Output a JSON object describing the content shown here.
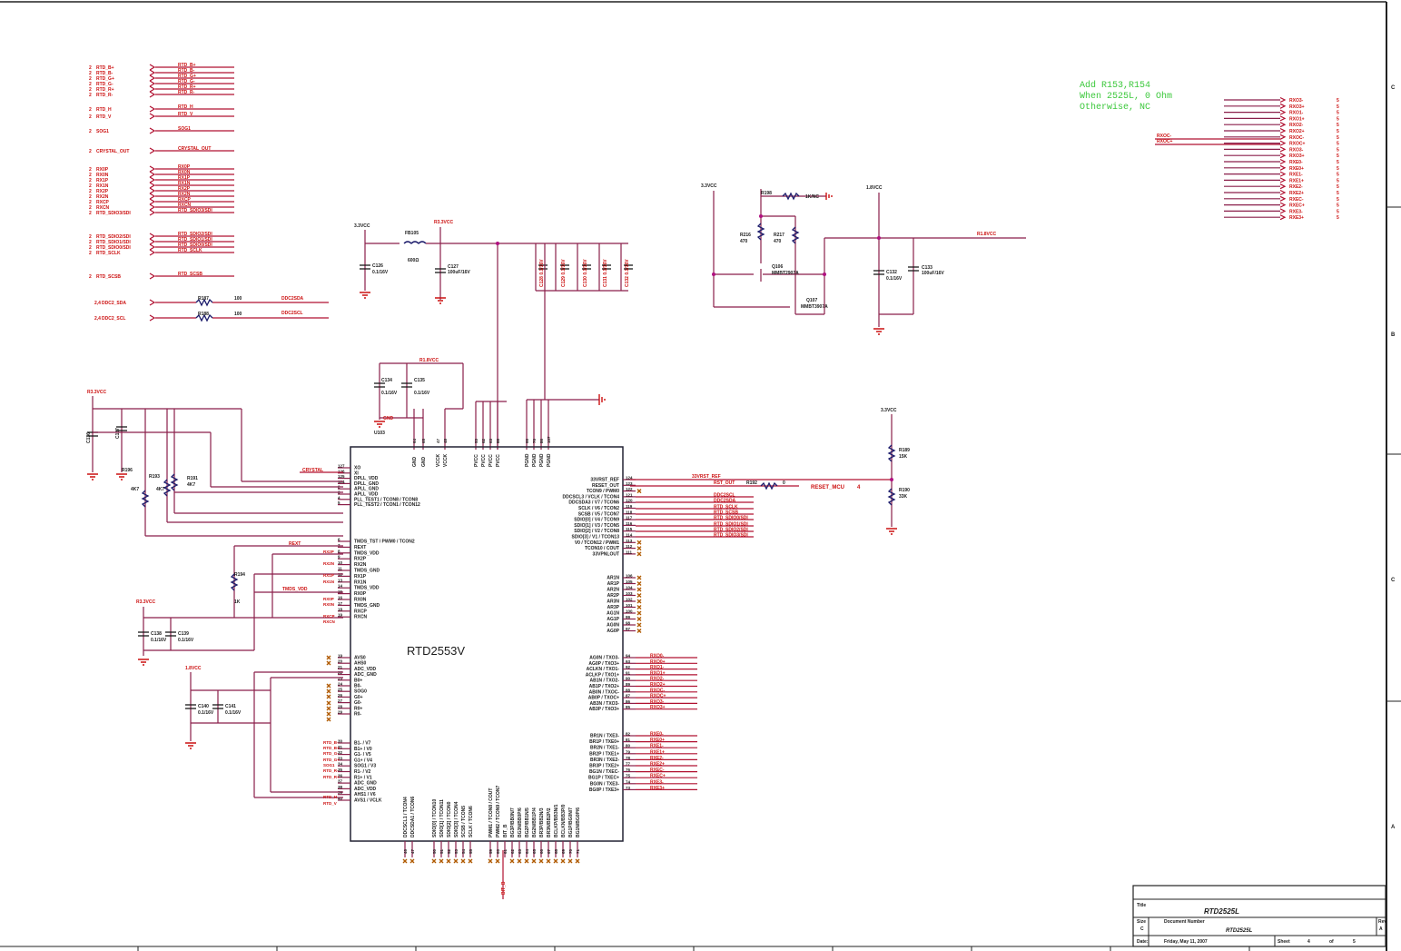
{
  "chip": {
    "name": "RTD2553V",
    "left_pins": [
      {
        "num": "127",
        "name": "XO"
      },
      {
        "num": "126",
        "name": "XI"
      },
      {
        "num": "125",
        "name": "DPLL_VDD"
      },
      {
        "num": "124",
        "name": "DPLL_GND"
      },
      {
        "num": "2",
        "name": "APLL_GND"
      },
      {
        "num": "3",
        "name": "APLL_VDD"
      },
      {
        "num": "4",
        "name": "PLL_TEST1 / TCON8 / TCON8"
      },
      {
        "num": "5",
        "name": "PLL_TEST2 / TCON1 / TCON12"
      },
      {
        "num": "6",
        "name": "TMDS_TST / PWM0 / TCON2"
      },
      {
        "num": "7",
        "name": "REXT"
      },
      {
        "num": "8",
        "name": "TMDS_VDD"
      },
      {
        "num": "9",
        "name": "RX2P"
      },
      {
        "num": "10",
        "name": "RX2N"
      },
      {
        "num": "11",
        "name": "TMDS_GND"
      },
      {
        "num": "12",
        "name": "RX1P"
      },
      {
        "num": "13",
        "name": "RX1N"
      },
      {
        "num": "14",
        "name": "TMDS_VDD"
      },
      {
        "num": "15",
        "name": "RX0P"
      },
      {
        "num": "16",
        "name": "RX0N"
      },
      {
        "num": "17",
        "name": "TMDS_GND"
      },
      {
        "num": "18",
        "name": "RXCP"
      },
      {
        "num": "19",
        "name": "RXCN"
      },
      {
        "num": "19",
        "name": "AVS0"
      },
      {
        "num": "20",
        "name": "AHS0"
      },
      {
        "num": "21",
        "name": "ADC_VDD"
      },
      {
        "num": "22",
        "name": "ADC_GND"
      },
      {
        "num": "23",
        "name": "B0+"
      },
      {
        "num": "24",
        "name": "B0-"
      },
      {
        "num": "25",
        "name": "SOG0"
      },
      {
        "num": "26",
        "name": "G0+"
      },
      {
        "num": "27",
        "name": "G0-"
      },
      {
        "num": "28",
        "name": "R0+"
      },
      {
        "num": "29",
        "name": "R0-"
      },
      {
        "num": "30",
        "name": "B1- / V7"
      },
      {
        "num": "31",
        "name": "B1+ / V0"
      },
      {
        "num": "32",
        "name": "G1- / V5"
      },
      {
        "num": "33",
        "name": "G1+ / V4"
      },
      {
        "num": "34",
        "name": "SOG1 / V3"
      },
      {
        "num": "35",
        "name": "R1- / V2"
      },
      {
        "num": "36",
        "name": "R1+ / V1"
      },
      {
        "num": "37",
        "name": "ADC_GND"
      },
      {
        "num": "38",
        "name": "ADC_VDD"
      },
      {
        "num": "39",
        "name": "AHS1 / V6"
      },
      {
        "num": "40",
        "name": "AVS1 / VCLK"
      }
    ],
    "right_pins": [
      {
        "num": "124",
        "name": "33VRST_REF"
      },
      {
        "num": "123",
        "name": "RESET_OUT"
      },
      {
        "num": "122",
        "name": "TCON9 / PWM0"
      },
      {
        "num": "121",
        "name": "DDCSCL3 / VCLK / TCON4"
      },
      {
        "num": "120",
        "name": "DDCSDA3 / V7 / TCON6"
      },
      {
        "num": "119",
        "name": "SCLK / V6 / TCON2"
      },
      {
        "num": "118",
        "name": "SCSB / V5 / TCON7"
      },
      {
        "num": "117",
        "name": "SDIO[0] / V4 / TCON9"
      },
      {
        "num": "116",
        "name": "SDIO[1] / V3 / TCON5"
      },
      {
        "num": "115",
        "name": "SDIO[2] / V2 / TCON8"
      },
      {
        "num": "114",
        "name": "SDIO[3] / V1 / TCON13"
      },
      {
        "num": "113",
        "name": "V0 / TCON12 / PWM1"
      },
      {
        "num": "112",
        "name": "TCON10 / COUT"
      },
      {
        "num": "111",
        "name": "33VPNLOUT"
      },
      {
        "num": "106",
        "name": "AR1N"
      },
      {
        "num": "105",
        "name": "AR1P"
      },
      {
        "num": "104",
        "name": "AR2N"
      },
      {
        "num": "103",
        "name": "AR2P"
      },
      {
        "num": "102",
        "name": "AR3N"
      },
      {
        "num": "101",
        "name": "AR3P"
      },
      {
        "num": "100",
        "name": "AG1N"
      },
      {
        "num": "99",
        "name": "AG1P"
      },
      {
        "num": "98",
        "name": "AG0N"
      },
      {
        "num": "97",
        "name": "AG0P"
      },
      {
        "num": "94",
        "name": "AG0N / TXO3-"
      },
      {
        "num": "93",
        "name": "AG0P / TXO3+"
      },
      {
        "num": "92",
        "name": "ACLKN / TXO1-"
      },
      {
        "num": "91",
        "name": "ACLKP / TXO1+"
      },
      {
        "num": "90",
        "name": "AB1N / TXO2-"
      },
      {
        "num": "89",
        "name": "AB1P / TXO2+"
      },
      {
        "num": "88",
        "name": "AB0N / TXOC-"
      },
      {
        "num": "87",
        "name": "AB0P / TXOC+"
      },
      {
        "num": "86",
        "name": "AB3N / TXO3-"
      },
      {
        "num": "85",
        "name": "AB3P / TXO3+"
      },
      {
        "num": "82",
        "name": "BR1N / TXE3-"
      },
      {
        "num": "81",
        "name": "BR1P / TXE0+"
      },
      {
        "num": "80",
        "name": "BR2N / TXE1-"
      },
      {
        "num": "79",
        "name": "BR2P / TXE1+"
      },
      {
        "num": "78",
        "name": "BR3N / TXE2-"
      },
      {
        "num": "77",
        "name": "BR3P / TXE2+"
      },
      {
        "num": "76",
        "name": "BG1N / TXEC-"
      },
      {
        "num": "75",
        "name": "BG1P / TXEC+"
      },
      {
        "num": "74",
        "name": "BG0N / TXE3-"
      },
      {
        "num": "73",
        "name": "BG0P / TXE3+"
      }
    ],
    "top_pins": [
      {
        "num": "64",
        "name": "GND"
      },
      {
        "num": "65",
        "name": "GND"
      },
      {
        "num": "47",
        "name": "VCCK"
      },
      {
        "num": "48",
        "name": "VCCK"
      },
      {
        "num": "53",
        "name": "PVCC"
      },
      {
        "num": "62",
        "name": "PVCC"
      },
      {
        "num": "63",
        "name": "PVCC"
      },
      {
        "num": "88",
        "name": "PVCC"
      },
      {
        "num": "66",
        "name": "PGND"
      },
      {
        "num": "76",
        "name": "PGND"
      },
      {
        "num": "86",
        "name": "PGND"
      },
      {
        "num": "107",
        "name": "PGND"
      }
    ],
    "bottom_pins": [
      {
        "num": "46",
        "name": "DDCSCL1 / TCON4"
      },
      {
        "num": "47",
        "name": "DDCSDA1 / TCON6"
      },
      {
        "num": "50",
        "name": "SDIO[0] / TCON10"
      },
      {
        "num": "51",
        "name": "SDIO[1] / TCON11"
      },
      {
        "num": "52",
        "name": "SDIO[2] / TCON0"
      },
      {
        "num": "53",
        "name": "SDIO[3] / TCON4"
      },
      {
        "num": "54",
        "name": "SCSB / TCON5"
      },
      {
        "num": "55",
        "name": "SCLK / TCON6"
      },
      {
        "num": "59",
        "name": "PWM1 / TCON8 / COUT"
      },
      {
        "num": "60",
        "name": "PWM2 / TCON9 / TCON7"
      },
      {
        "num": "61",
        "name": "BIT_B"
      },
      {
        "num": "62",
        "name": "BG3P/BB0N/7"
      },
      {
        "num": "63",
        "name": "BG3N/BB0P/6"
      },
      {
        "num": "64",
        "name": "BG2P/BB1N/5"
      },
      {
        "num": "65",
        "name": "BG2N/BB1P/4"
      },
      {
        "num": "66",
        "name": "BR3P/BB2N/3"
      },
      {
        "num": "67",
        "name": "BR3N/BB2P/2"
      },
      {
        "num": "68",
        "name": "BCLKP/BB3N/1"
      },
      {
        "num": "69",
        "name": "BCLKN/BB3P/0"
      },
      {
        "num": "70",
        "name": "BG1P/BG0N/7"
      },
      {
        "num": "71",
        "name": "BG1N/BG0P/6"
      }
    ],
    "top_label_wire": "BIT_B"
  },
  "left_ports": [
    {
      "sheet": "2",
      "name": "RTD_B+",
      "net": "RTD_B+"
    },
    {
      "sheet": "2",
      "name": "RTD_B-",
      "net": "RTD_B-"
    },
    {
      "sheet": "2",
      "name": "RTD_G+",
      "net": "RTD_G+"
    },
    {
      "sheet": "2",
      "name": "RTD_G-",
      "net": "RTD_G-"
    },
    {
      "sheet": "2",
      "name": "RTD_R+",
      "net": "RTD_R+"
    },
    {
      "sheet": "2",
      "name": "RTD_R-",
      "net": "RTD_R-"
    },
    {
      "sheet": "2",
      "name": "RTD_H",
      "net": "RTD_H"
    },
    {
      "sheet": "2",
      "name": "RTD_V",
      "net": "RTD_V"
    },
    {
      "sheet": "2",
      "name": "SOG1",
      "net": "SOG1"
    },
    {
      "sheet": "2",
      "name": "CRYSTAL_OUT",
      "net": "CRYSTAL_OUT"
    },
    {
      "sheet": "2",
      "name": "RX0P",
      "net": "RX0P"
    },
    {
      "sheet": "2",
      "name": "RX0N",
      "net": "RX0N"
    },
    {
      "sheet": "2",
      "name": "RX1P",
      "net": "RX1P"
    },
    {
      "sheet": "2",
      "name": "RX1N",
      "net": "RX1N"
    },
    {
      "sheet": "2",
      "name": "RX2P",
      "net": "RX2P"
    },
    {
      "sheet": "2",
      "name": "RX2N",
      "net": "RX2N"
    },
    {
      "sheet": "2",
      "name": "RXCP",
      "net": "RXCP"
    },
    {
      "sheet": "2",
      "name": "RXCN",
      "net": "RXCN"
    },
    {
      "sheet": "2",
      "name": "RTD_SDIO3/SDI",
      "net": "RTD_SDIO3/SDI"
    },
    {
      "sheet": "2",
      "name": "RTD_SDIO2/SDI",
      "net": "RTD_SDIO2/SDI"
    },
    {
      "sheet": "2",
      "name": "RTD_SDIO1/SDI",
      "net": "RTD_SDIO1/SDI"
    },
    {
      "sheet": "2",
      "name": "RTD_SDIO0/SDI",
      "net": "RTD_SDIO0/SDI"
    },
    {
      "sheet": "2",
      "name": "RTD_SCLK",
      "net": "RTD_SCLK"
    },
    {
      "sheet": "2",
      "name": "RTD_SCSB",
      "net": "RTD_SCSB"
    },
    {
      "sheet": "2,4",
      "name": "DDC2_SDA",
      "net": "DDC2SDA"
    },
    {
      "sheet": "2,4",
      "name": "DDC2_SCL",
      "net": "DDC2SCL"
    }
  ],
  "ddc_resistors": [
    {
      "ref": "R187",
      "value": "100"
    },
    {
      "ref": "R188",
      "value": "100"
    }
  ],
  "right_ports": [
    {
      "net": "RXO3-",
      "sheet": "5"
    },
    {
      "net": "RXO3+",
      "sheet": "5"
    },
    {
      "net": "RXO1-",
      "sheet": "5"
    },
    {
      "net": "RXO1+",
      "sheet": "5"
    },
    {
      "net": "RXO2-",
      "sheet": "5"
    },
    {
      "net": "RXO2+",
      "sheet": "5"
    },
    {
      "net": "RXOC-",
      "sheet": "5"
    },
    {
      "net": "RXOC+",
      "sheet": "5"
    },
    {
      "net": "RXO3-",
      "sheet": "5"
    },
    {
      "net": "RXO3+",
      "sheet": "5"
    },
    {
      "net": "RXE0-",
      "sheet": "5"
    },
    {
      "net": "RXE0+",
      "sheet": "5"
    },
    {
      "net": "RXE1-",
      "sheet": "5"
    },
    {
      "net": "RXE1+",
      "sheet": "5"
    },
    {
      "net": "RXE2-",
      "sheet": "5"
    },
    {
      "net": "RXE2+",
      "sheet": "5"
    },
    {
      "net": "RXEC-",
      "sheet": "5"
    },
    {
      "net": "RXEC+",
      "sheet": "5"
    },
    {
      "net": "RXE3-",
      "sheet": "5"
    },
    {
      "net": "RXE3+",
      "sheet": "5"
    }
  ],
  "right_port_wires": [
    "RXOC-",
    "RXOC+"
  ],
  "note": [
    "Add R153,R154",
    "When 2525L, 0 Ohm",
    "Otherwise, NC"
  ],
  "lvds_nets_odd": [
    "RXO0-",
    "RXO0+",
    "RXO1-",
    "RXO1+",
    "RXO2-",
    "RXO2+",
    "RXOC-",
    "RXOC+",
    "RXO3-",
    "RXO3+"
  ],
  "lvds_nets_even": [
    "RXE0-",
    "RXE0+",
    "RXE1-",
    "RXE1+",
    "RXE2-",
    "RXE2+",
    "RXEC-",
    "RXEC+",
    "RXE3-",
    "RXE3+"
  ],
  "right_ctrl_nets": [
    "33VRST_REF",
    "RST_OUT"
  ],
  "right_ctrl_nets2": [
    "DDC2SCL",
    "DDC2SDA",
    "RTD_SCLK",
    "RTD_SCSB",
    "RTD_SDIO0/SDI",
    "RTD_SDIO1/SDI",
    "RTD_SDIO2/SDI",
    "RTD_SDIO3/SDI"
  ],
  "reset_port": {
    "name": "RESET_MCU",
    "sheet": "4",
    "res": "R192",
    "rval": "0"
  },
  "power": {
    "v33": "3.3VCC",
    "r18": "R1.8VCC",
    "v18": "1.8VCC",
    "r33": "R3.3VCC",
    "g": "GND",
    "fb": {
      "ref": "FB105",
      "value": "600Ω"
    },
    "c126": {
      "ref": "C126",
      "value": "0.1/16V"
    },
    "c127": {
      "ref": "C127",
      "value": "100uF/16V"
    },
    "c_bank": [
      "C128 0.1/16V",
      "C129 0.1/16V",
      "C130 0.1/16V",
      "C131 0.1/16V",
      "C132 0.1/16V"
    ],
    "c134": {
      "ref": "C134",
      "value": "0.1/16V"
    },
    "c135": {
      "ref": "C135",
      "value": "0.1/16V"
    },
    "u": "U103",
    "q106": {
      "ref": "Q106",
      "value": "MMBT2907A"
    },
    "q107": {
      "ref": "Q107",
      "value": "MMBT3907A"
    },
    "r216": {
      "ref": "R216",
      "value": "470"
    },
    "r217": {
      "ref": "R217",
      "value": "470"
    },
    "r198": {
      "ref": "R198",
      "value": "1K/NC"
    },
    "c132b": {
      "ref": "C132",
      "value": "0.1/16V"
    },
    "c133": {
      "ref": "C133",
      "value": "100uF/16V"
    },
    "r189": {
      "ref": "R189",
      "value": "15K"
    },
    "r190": {
      "ref": "R190",
      "value": "33K"
    },
    "r196": {
      "ref": "R196",
      "value": "4K7"
    },
    "r193": {
      "ref": "R193",
      "value": "4K7"
    },
    "r191": {
      "ref": "R191",
      "value": "4K7"
    },
    "r194": {
      "ref": "R194",
      "value": "1K"
    },
    "c136": {
      "ref": "C136",
      "value": "0.1/16V"
    },
    "c137": {
      "ref": "C137",
      "value": "0.1/16V"
    },
    "c138": {
      "ref": "C138",
      "value": "0.1/16V"
    },
    "c139": {
      "ref": "C139",
      "value": "0.1/16V"
    },
    "c140": {
      "ref": "C140",
      "value": "0.1/16V"
    },
    "c141": {
      "ref": "C141",
      "value": "0.1/16V"
    },
    "nets": {
      "crystal": "CRYSTAL",
      "rext": "REXT",
      "tmds": "TMDS_VDD"
    },
    "left_rx_nets": [
      "RX2P",
      "RX2N",
      "RX1P",
      "RX1N",
      "RX0P",
      "RX0N",
      "RXCP",
      "RXCN"
    ],
    "left_adc_nets": [
      "RTD_B-",
      "RTD_B+",
      "RTD_G-",
      "RTD_G+",
      "SOG1",
      "RTD_R-",
      "RTD_R+",
      "RTD_H",
      "RTD_V"
    ]
  },
  "title_block": {
    "title_label": "Title",
    "title": "RTD2525L",
    "size_label": "Size",
    "size": "C",
    "docnum_label": "Document Number",
    "docnum": "RTD2525L",
    "rev_label": "Rev",
    "rev": "A",
    "date_label": "Date:",
    "date": "Friday, May 11, 2007",
    "sheet_label": "Sheet",
    "sheet": "4",
    "of_label": "of",
    "of": "5"
  },
  "border_marks": [
    "C",
    "B",
    "C",
    "B",
    "A"
  ]
}
